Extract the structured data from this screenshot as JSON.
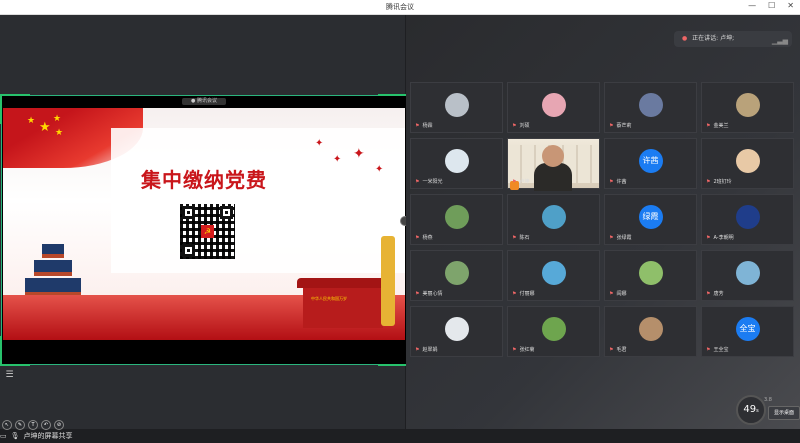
{
  "window": {
    "title": "腾讯会议",
    "minimize": "—",
    "maximize": "☐",
    "close": "✕"
  },
  "share": {
    "sharer_tag": "● 腾讯会议",
    "slide_title": "集中缴纳党费",
    "banner_text": "中华人民共和国万岁"
  },
  "bottom": {
    "presenter": "卢坤的屏幕共享"
  },
  "speaking": {
    "label": "正在讲话: 卢坤;"
  },
  "participants": [
    {
      "name": "杨霖",
      "avatar": "photo",
      "color": "#b9c0c8"
    },
    {
      "name": "刘硕",
      "avatar": "photo",
      "color": "#e7a6b3"
    },
    {
      "name": "蔡芒莉",
      "avatar": "photo",
      "color": "#6a7aa0"
    },
    {
      "name": "金美兰",
      "avatar": "photo",
      "color": "#b9a27a"
    },
    {
      "name": "一米阳光",
      "avatar": "photo",
      "color": "#dde7ee"
    },
    {
      "name": "卢坤",
      "avatar": "video",
      "color": "#c89676"
    },
    {
      "name": "许茜",
      "avatar": "text",
      "text": "许茜",
      "color": "#1b7cf2"
    },
    {
      "name": "2班钉玲",
      "avatar": "photo",
      "color": "#e8c9a6"
    },
    {
      "name": "杨燕",
      "avatar": "photo",
      "color": "#6f9d5a"
    },
    {
      "name": "陈石",
      "avatar": "photo",
      "color": "#4fa0c8"
    },
    {
      "name": "张绿霞",
      "avatar": "text",
      "text": "绿霞",
      "color": "#1b7cf2"
    },
    {
      "name": "A-李朝明",
      "avatar": "photo",
      "color": "#1f3d8a"
    },
    {
      "name": "美丽心情",
      "avatar": "photo",
      "color": "#7ea46c"
    },
    {
      "name": "付丽娜",
      "avatar": "photo",
      "color": "#57a9d8"
    },
    {
      "name": "阎娜",
      "avatar": "photo",
      "color": "#8fbf6a"
    },
    {
      "name": "唐芳",
      "avatar": "photo",
      "color": "#7fb4d6"
    },
    {
      "name": "赵翠娟",
      "avatar": "photo",
      "color": "#e4e8ec"
    },
    {
      "name": "张红菊",
      "avatar": "photo",
      "color": "#6ea54e"
    },
    {
      "name": "毛君",
      "avatar": "photo",
      "color": "#b58f6b"
    },
    {
      "name": "王全宝",
      "avatar": "text",
      "text": "全宝",
      "color": "#1b7cf2"
    }
  ],
  "timer": {
    "value": "49",
    "unit": "s"
  },
  "stat": "3.8",
  "show_desktop": "显示桌面"
}
